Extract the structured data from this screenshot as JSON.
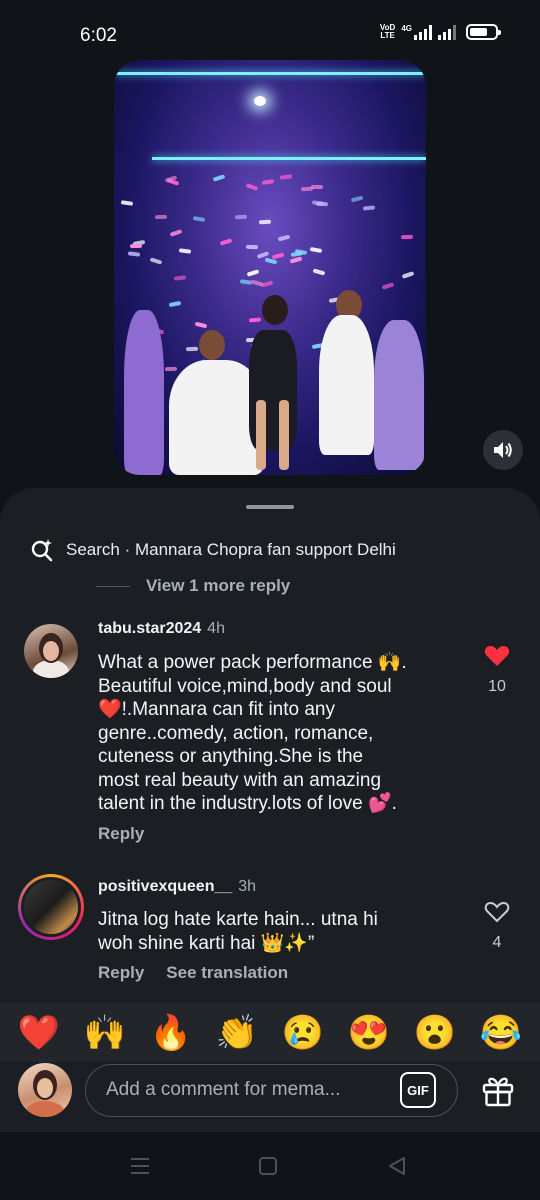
{
  "status_bar": {
    "time": "6:02",
    "network_tag_top": "VoD",
    "network_tag_bottom": "LTE",
    "signal_type": "4G",
    "battery_level": 0.7
  },
  "video": {
    "sound_icon": "speaker-icon"
  },
  "comments_sheet": {
    "search": {
      "icon": "search-sparkle-icon",
      "label": "Search · Mannara Chopra fan support Delhi"
    },
    "view_more_replies": "View 1 more reply",
    "comments": [
      {
        "username": "tabu.star2024",
        "time": "4h",
        "lines": [
          "What a power pack performance 🙌.",
          "Beautiful voice,mind,body and soul",
          "❤️!.Mannara can fit into any",
          "genre..comedy, action, romance,",
          "cuteness or  anything.She is the",
          "most real beauty with an amazing",
          "talent in the industry.lots of love 💕."
        ],
        "reply_label": "Reply",
        "liked": true,
        "like_count": "10"
      },
      {
        "username": "positivexqueen__",
        "time": "3h",
        "lines": [
          "Jitna log hate karte hain... utna hi",
          "woh shine karti hai 👑✨”"
        ],
        "reply_label": "Reply",
        "translate_label": "See translation",
        "liked": false,
        "like_count": "4"
      }
    ]
  },
  "reactions": [
    "❤️",
    "🙌",
    "🔥",
    "👏",
    "😢",
    "😍",
    "😮",
    "😂"
  ],
  "composer": {
    "placeholder": "Add a comment for mema...",
    "gif_label": "GIF",
    "gift_icon": "gift-icon"
  },
  "colors": {
    "background": "#101418",
    "sheet": "#1b1f23",
    "like_red": "#ff3040",
    "muted_text": "#a8b0b6"
  }
}
